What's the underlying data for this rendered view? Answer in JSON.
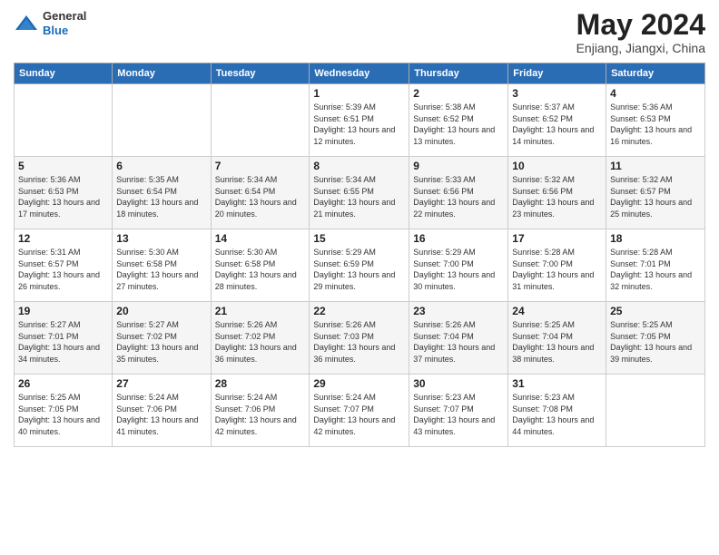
{
  "header": {
    "logo_general": "General",
    "logo_blue": "Blue",
    "month": "May 2024",
    "location": "Enjiang, Jiangxi, China"
  },
  "days_of_week": [
    "Sunday",
    "Monday",
    "Tuesday",
    "Wednesday",
    "Thursday",
    "Friday",
    "Saturday"
  ],
  "weeks": [
    [
      {
        "day": "",
        "info": ""
      },
      {
        "day": "",
        "info": ""
      },
      {
        "day": "",
        "info": ""
      },
      {
        "day": "1",
        "info": "Sunrise: 5:39 AM\nSunset: 6:51 PM\nDaylight: 13 hours\nand 12 minutes."
      },
      {
        "day": "2",
        "info": "Sunrise: 5:38 AM\nSunset: 6:52 PM\nDaylight: 13 hours\nand 13 minutes."
      },
      {
        "day": "3",
        "info": "Sunrise: 5:37 AM\nSunset: 6:52 PM\nDaylight: 13 hours\nand 14 minutes."
      },
      {
        "day": "4",
        "info": "Sunrise: 5:36 AM\nSunset: 6:53 PM\nDaylight: 13 hours\nand 16 minutes."
      }
    ],
    [
      {
        "day": "5",
        "info": "Sunrise: 5:36 AM\nSunset: 6:53 PM\nDaylight: 13 hours\nand 17 minutes."
      },
      {
        "day": "6",
        "info": "Sunrise: 5:35 AM\nSunset: 6:54 PM\nDaylight: 13 hours\nand 18 minutes."
      },
      {
        "day": "7",
        "info": "Sunrise: 5:34 AM\nSunset: 6:54 PM\nDaylight: 13 hours\nand 20 minutes."
      },
      {
        "day": "8",
        "info": "Sunrise: 5:34 AM\nSunset: 6:55 PM\nDaylight: 13 hours\nand 21 minutes."
      },
      {
        "day": "9",
        "info": "Sunrise: 5:33 AM\nSunset: 6:56 PM\nDaylight: 13 hours\nand 22 minutes."
      },
      {
        "day": "10",
        "info": "Sunrise: 5:32 AM\nSunset: 6:56 PM\nDaylight: 13 hours\nand 23 minutes."
      },
      {
        "day": "11",
        "info": "Sunrise: 5:32 AM\nSunset: 6:57 PM\nDaylight: 13 hours\nand 25 minutes."
      }
    ],
    [
      {
        "day": "12",
        "info": "Sunrise: 5:31 AM\nSunset: 6:57 PM\nDaylight: 13 hours\nand 26 minutes."
      },
      {
        "day": "13",
        "info": "Sunrise: 5:30 AM\nSunset: 6:58 PM\nDaylight: 13 hours\nand 27 minutes."
      },
      {
        "day": "14",
        "info": "Sunrise: 5:30 AM\nSunset: 6:58 PM\nDaylight: 13 hours\nand 28 minutes."
      },
      {
        "day": "15",
        "info": "Sunrise: 5:29 AM\nSunset: 6:59 PM\nDaylight: 13 hours\nand 29 minutes."
      },
      {
        "day": "16",
        "info": "Sunrise: 5:29 AM\nSunset: 7:00 PM\nDaylight: 13 hours\nand 30 minutes."
      },
      {
        "day": "17",
        "info": "Sunrise: 5:28 AM\nSunset: 7:00 PM\nDaylight: 13 hours\nand 31 minutes."
      },
      {
        "day": "18",
        "info": "Sunrise: 5:28 AM\nSunset: 7:01 PM\nDaylight: 13 hours\nand 32 minutes."
      }
    ],
    [
      {
        "day": "19",
        "info": "Sunrise: 5:27 AM\nSunset: 7:01 PM\nDaylight: 13 hours\nand 34 minutes."
      },
      {
        "day": "20",
        "info": "Sunrise: 5:27 AM\nSunset: 7:02 PM\nDaylight: 13 hours\nand 35 minutes."
      },
      {
        "day": "21",
        "info": "Sunrise: 5:26 AM\nSunset: 7:02 PM\nDaylight: 13 hours\nand 36 minutes."
      },
      {
        "day": "22",
        "info": "Sunrise: 5:26 AM\nSunset: 7:03 PM\nDaylight: 13 hours\nand 36 minutes."
      },
      {
        "day": "23",
        "info": "Sunrise: 5:26 AM\nSunset: 7:04 PM\nDaylight: 13 hours\nand 37 minutes."
      },
      {
        "day": "24",
        "info": "Sunrise: 5:25 AM\nSunset: 7:04 PM\nDaylight: 13 hours\nand 38 minutes."
      },
      {
        "day": "25",
        "info": "Sunrise: 5:25 AM\nSunset: 7:05 PM\nDaylight: 13 hours\nand 39 minutes."
      }
    ],
    [
      {
        "day": "26",
        "info": "Sunrise: 5:25 AM\nSunset: 7:05 PM\nDaylight: 13 hours\nand 40 minutes."
      },
      {
        "day": "27",
        "info": "Sunrise: 5:24 AM\nSunset: 7:06 PM\nDaylight: 13 hours\nand 41 minutes."
      },
      {
        "day": "28",
        "info": "Sunrise: 5:24 AM\nSunset: 7:06 PM\nDaylight: 13 hours\nand 42 minutes."
      },
      {
        "day": "29",
        "info": "Sunrise: 5:24 AM\nSunset: 7:07 PM\nDaylight: 13 hours\nand 42 minutes."
      },
      {
        "day": "30",
        "info": "Sunrise: 5:23 AM\nSunset: 7:07 PM\nDaylight: 13 hours\nand 43 minutes."
      },
      {
        "day": "31",
        "info": "Sunrise: 5:23 AM\nSunset: 7:08 PM\nDaylight: 13 hours\nand 44 minutes."
      },
      {
        "day": "",
        "info": ""
      }
    ]
  ]
}
